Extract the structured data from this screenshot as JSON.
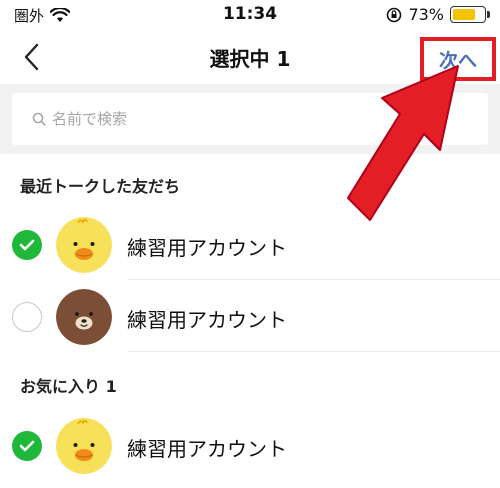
{
  "status_bar": {
    "carrier": "圏外",
    "time": "11:34",
    "battery_percent": "73%",
    "battery_level": 0.73,
    "icons": [
      "wifi-icon",
      "orientation-lock-icon",
      "battery-icon"
    ]
  },
  "nav": {
    "title": "選択中 1",
    "next_label": "次へ",
    "back_icon": "chevron-left-icon"
  },
  "search": {
    "placeholder": "名前で検索",
    "icon": "search-icon"
  },
  "sections": [
    {
      "header": "最近トークした友だち",
      "rows": [
        {
          "name": "練習用アカウント",
          "checked": true,
          "avatar": "sally-chick-avatar"
        },
        {
          "name": "練習用アカウント",
          "checked": false,
          "avatar": "brown-bear-avatar"
        }
      ]
    },
    {
      "header": "お気に入り 1",
      "rows": [
        {
          "name": "練習用アカウント",
          "checked": true,
          "avatar": "sally-chick-avatar"
        }
      ]
    }
  ],
  "colors": {
    "accent_blue": "#4a6fb5",
    "highlight_red": "#e31e24",
    "check_green": "#1fb83b",
    "search_bg": "#f2f2f2"
  }
}
